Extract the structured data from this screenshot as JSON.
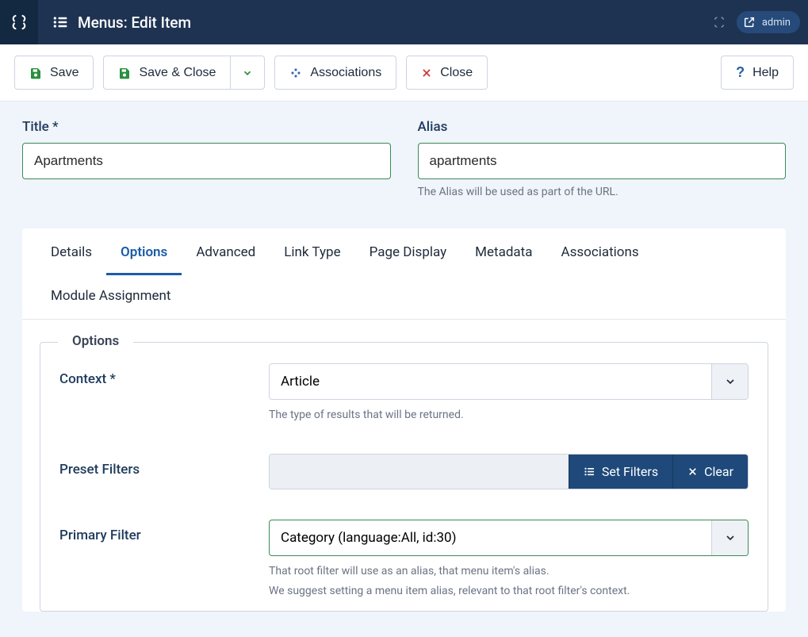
{
  "header": {
    "title": "Menus: Edit Item",
    "admin_label": "admin"
  },
  "toolbar": {
    "save": "Save",
    "save_close": "Save & Close",
    "associations": "Associations",
    "close": "Close",
    "help": "Help"
  },
  "fields": {
    "title_label": "Title *",
    "title_value": "Apartments",
    "alias_label": "Alias",
    "alias_value": "apartments",
    "alias_desc": "The Alias will be used as part of the URL."
  },
  "tabs": {
    "details": "Details",
    "options": "Options",
    "advanced": "Advanced",
    "link_type": "Link Type",
    "page_display": "Page Display",
    "metadata": "Metadata",
    "associations": "Associations",
    "module_assignment": "Module Assignment"
  },
  "options": {
    "legend": "Options",
    "context_label": "Context *",
    "context_value": "Article",
    "context_desc": "The type of results that will be returned.",
    "preset_filters_label": "Preset Filters",
    "set_filters": "Set Filters",
    "clear": "Clear",
    "primary_filter_label": "Primary Filter",
    "primary_filter_value": "Category (language:All, id:30)",
    "primary_filter_desc1": "That root filter will use as an alias, that menu item's alias.",
    "primary_filter_desc2": "We suggest setting a menu item alias, relevant to that root filter's context."
  }
}
